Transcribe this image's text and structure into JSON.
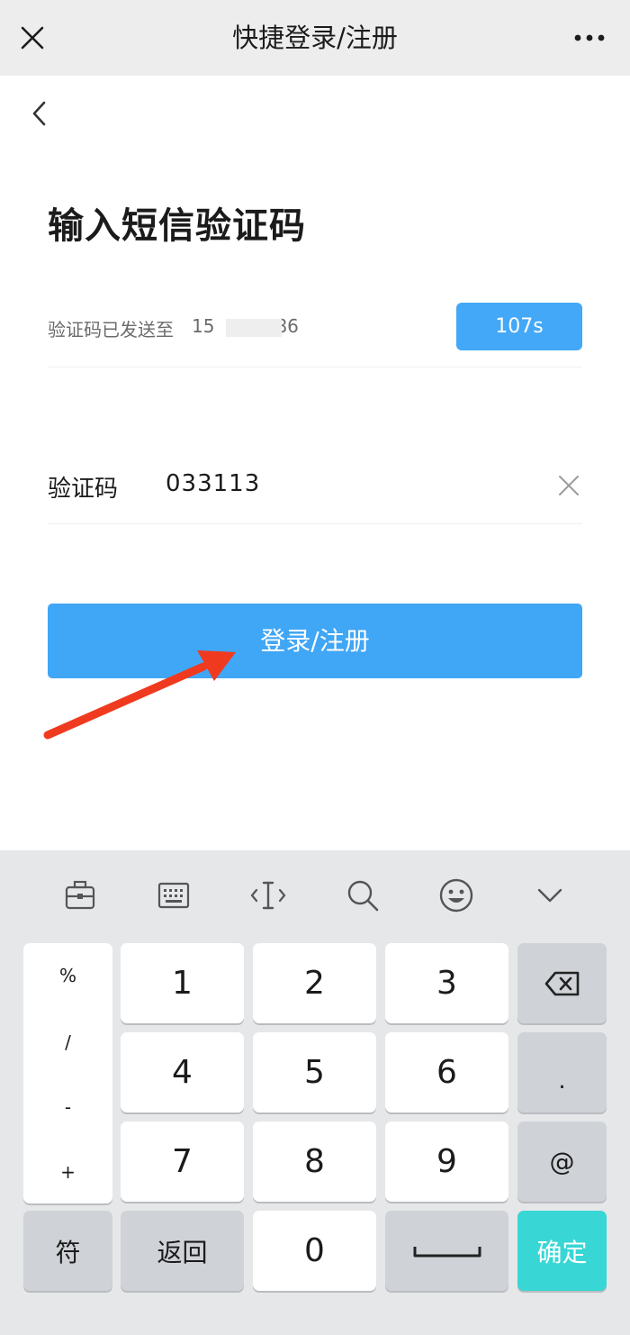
{
  "topbar": {
    "title": "快捷登录/注册",
    "close_icon": "close-icon",
    "more_icon": "more-dots-icon"
  },
  "back_icon": "chevron-left-icon",
  "heading": "输入短信验证码",
  "sms": {
    "sent_label": "验证码已发送至",
    "phone_prefix": "15",
    "phone_suffix": "86",
    "countdown": "107s"
  },
  "code": {
    "label": "验证码",
    "value": "033113",
    "clear_icon": "clear-x-icon"
  },
  "login_button": "登录/注册",
  "keyboard": {
    "toolbar_icons": [
      "toolbox-icon",
      "keyboard-icon",
      "cursor-icon",
      "search-icon",
      "emoji-icon",
      "chevron-down-icon"
    ],
    "symbols": [
      "%",
      "/",
      "-",
      "+"
    ],
    "digits": [
      "1",
      "2",
      "3",
      "4",
      "5",
      "6",
      "7",
      "8",
      "9",
      "0"
    ],
    "delete_icon": "backspace-icon",
    "dot": ".",
    "at": "@",
    "symbols_key": "符",
    "back_key": "返回",
    "space_icon": "space-bar-icon",
    "confirm_key": "确定"
  },
  "colors": {
    "accent": "#40a6f6",
    "confirm": "#38d6d5",
    "arrow": "#f03a20"
  }
}
